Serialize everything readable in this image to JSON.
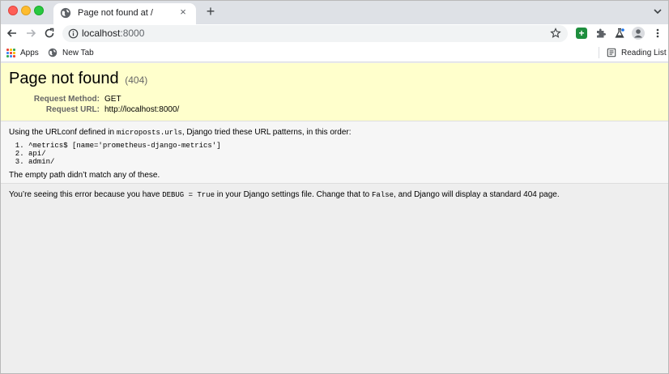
{
  "tab": {
    "title": "Page not found at /",
    "close": "×",
    "new_tab": "+"
  },
  "omnibox": {
    "host": "localhost",
    "port": ":8000"
  },
  "bookmarks": {
    "apps": "Apps",
    "new_tab": "New Tab",
    "reading_list": "Reading List"
  },
  "apps_colors": [
    "#ea4335",
    "#fbbc04",
    "#34a853",
    "#4285f4",
    "#ea4335",
    "#fbbc04",
    "#34a853",
    "#4285f4",
    "#ea4335"
  ],
  "page": {
    "title": "Page not found",
    "status": "(404)",
    "request_method_label": "Request Method:",
    "request_method": "GET",
    "request_url_label": "Request URL:",
    "request_url": "http://localhost:8000/",
    "urlconf_prefix": "Using the URLconf defined in ",
    "urlconf_module": "microposts.urls",
    "urlconf_suffix": ", Django tried these URL patterns, in this order:",
    "patterns": [
      "^metrics$ [name='prometheus-django-metrics']",
      "api/",
      "admin/"
    ],
    "no_match": "The empty path didn’t match any of these.",
    "debug_prefix": "You’re seeing this error because you have ",
    "debug_setting": "DEBUG = True",
    "debug_middle": " in your Django settings file. Change that to ",
    "debug_false": "False",
    "debug_suffix": ", and Django will display a standard 404 page."
  }
}
